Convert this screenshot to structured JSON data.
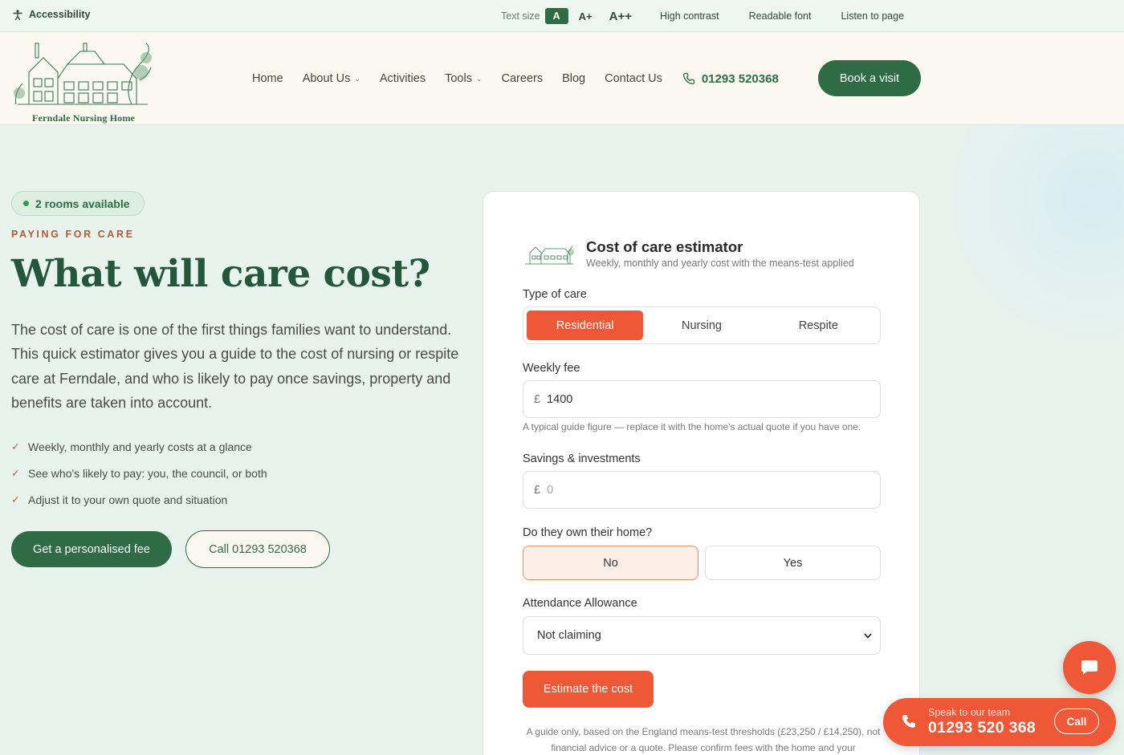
{
  "accessibility_bar": {
    "label": "Accessibility",
    "text_size_label": "Text size",
    "size_a": "A",
    "size_a_plus": "A+",
    "size_a_plus_plus": "A++",
    "high_contrast": "High contrast",
    "readable_font": "Readable font",
    "listen": "Listen to page"
  },
  "header": {
    "logo_text": "Ferndale Nursing Home",
    "nav": {
      "home": "Home",
      "about": "About Us",
      "activities": "Activities",
      "tools": "Tools",
      "careers": "Careers",
      "blog": "Blog",
      "contact": "Contact Us",
      "phone": "01293 520368"
    },
    "book_label": "Book a visit"
  },
  "hero": {
    "badge": "2 rooms available",
    "eyebrow": "PAYING FOR CARE",
    "title": "What will care cost?",
    "lead": "The cost of care is one of the first things families want to understand. This quick estimator gives you a guide to the cost of nursing or respite care at Ferndale, and who is likely to pay once savings, property and benefits are taken into account.",
    "checks": [
      "Weekly, monthly and yearly costs at a glance",
      "See who's likely to pay: you, the council, or both",
      "Adjust it to your own quote and situation"
    ],
    "primary_cta": "Get a personalised fee",
    "secondary_cta": "Call 01293 520368"
  },
  "estimator": {
    "title": "Cost of care estimator",
    "subtitle": "Weekly, monthly and yearly cost with the means-test applied",
    "type_label": "Type of care",
    "type_options": [
      "Residential",
      "Nursing",
      "Respite"
    ],
    "type_selected": "Residential",
    "weekly_label": "Weekly fee",
    "currency": "£",
    "weekly_value": "1400",
    "weekly_hint": "A typical guide figure — replace it with the home's actual quote if you have one.",
    "savings_label": "Savings & investments",
    "savings_placeholder": "0",
    "own_home_label": "Do they own their home?",
    "own_home_no": "No",
    "own_home_yes": "Yes",
    "own_home_selected": "No",
    "attendance_label": "Attendance Allowance",
    "attendance_value": "Not claiming",
    "button": "Estimate the cost",
    "disclaimer": "A guide only, based on the England means-test thresholds (£23,250 / £14,250), not financial advice or a quote. Please confirm fees with the home and your"
  },
  "call_widget": {
    "small": "Speak to our team",
    "number": "01293 520 368",
    "call_label": "Call"
  },
  "colors": {
    "brand_green": "#2f6b45",
    "accent_orange": "#ef5836",
    "background": "#e9f3ee"
  },
  "icons": {
    "accessibility": "person-icon",
    "phone": "phone-icon",
    "chat": "chat-bubble-icon",
    "check": "check-icon",
    "chevron": "chevron-down-icon"
  }
}
